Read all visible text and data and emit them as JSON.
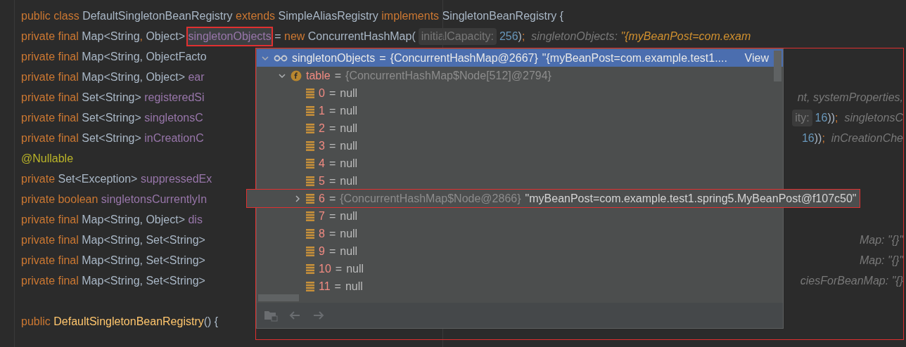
{
  "editor": {
    "lines": [
      {
        "tokens": [
          {
            "kind": "keyword",
            "text": "public class "
          },
          {
            "kind": "type",
            "text": "DefaultSingletonBeanRegistry "
          },
          {
            "kind": "keyword",
            "text": "extends "
          },
          {
            "kind": "type",
            "text": "SimpleAliasRegistry "
          },
          {
            "kind": "keyword",
            "text": "implements "
          },
          {
            "kind": "type",
            "text": "SingletonBeanRegistry {"
          }
        ]
      },
      {
        "tokens": [
          {
            "kind": "keyword",
            "text": "private final "
          },
          {
            "kind": "type",
            "text": "Map<String"
          },
          {
            "kind": "keyword",
            "text": ", "
          },
          {
            "kind": "type",
            "text": "Object> "
          },
          {
            "kind": "field",
            "text": "singletonObjects",
            "marked": true
          },
          {
            "kind": "type",
            "text": " = "
          },
          {
            "kind": "keyword",
            "text": "new "
          },
          {
            "kind": "type",
            "text": "ConcurrentHashMap("
          },
          {
            "kind": "hint",
            "text": "initialCapacity:"
          },
          {
            "kind": "number",
            "text": "256"
          },
          {
            "kind": "type",
            "text": ")"
          },
          {
            "kind": "keyword",
            "text": ";  "
          },
          {
            "kind": "inline",
            "text": "singletonObjects: "
          },
          {
            "kind": "inline-string",
            "text": "\"{myBeanPost=com.exam"
          }
        ]
      },
      {
        "tokens": [
          {
            "kind": "keyword",
            "text": "private final "
          },
          {
            "kind": "type",
            "text": "Map<String, ObjectFacto"
          }
        ]
      },
      {
        "tokens": [
          {
            "kind": "keyword",
            "text": "private final "
          },
          {
            "kind": "type",
            "text": "Map<String, Object> "
          },
          {
            "kind": "field",
            "text": "ear"
          }
        ]
      },
      {
        "tokens": [
          {
            "kind": "keyword",
            "text": "private final "
          },
          {
            "kind": "type",
            "text": "Set<String> "
          },
          {
            "kind": "field",
            "text": "registeredSi"
          }
        ],
        "right": [
          {
            "kind": "inline",
            "text": "nt, systemProperties,"
          }
        ]
      },
      {
        "tokens": [
          {
            "kind": "keyword",
            "text": "private final "
          },
          {
            "kind": "type",
            "text": "Set<String> "
          },
          {
            "kind": "field",
            "text": "singletonsC"
          }
        ],
        "right": [
          {
            "kind": "hint",
            "text": "ity:"
          },
          {
            "kind": "number",
            "text": "16"
          },
          {
            "kind": "type",
            "text": "))"
          },
          {
            "kind": "keyword",
            "text": ";  "
          },
          {
            "kind": "inline",
            "text": "singletonsC"
          }
        ]
      },
      {
        "tokens": [
          {
            "kind": "keyword",
            "text": "private final "
          },
          {
            "kind": "type",
            "text": "Set<String> "
          },
          {
            "kind": "field",
            "text": "inCreationC"
          }
        ],
        "right": [
          {
            "kind": "number",
            "text": "16"
          },
          {
            "kind": "type",
            "text": "))"
          },
          {
            "kind": "keyword",
            "text": ";  "
          },
          {
            "kind": "inline",
            "text": "inCreationChe"
          }
        ]
      },
      {
        "tokens": [
          {
            "kind": "annotation",
            "text": "@Nullable"
          }
        ]
      },
      {
        "tokens": [
          {
            "kind": "keyword",
            "text": "private "
          },
          {
            "kind": "type",
            "text": "Set<Exception> "
          },
          {
            "kind": "field",
            "text": "suppressedEx"
          }
        ]
      },
      {
        "tokens": [
          {
            "kind": "keyword",
            "text": "private boolean "
          },
          {
            "kind": "field",
            "text": "singletonsCurrentlyIn"
          }
        ]
      },
      {
        "tokens": [
          {
            "kind": "keyword",
            "text": "private final "
          },
          {
            "kind": "type",
            "text": "Map<String, Object> "
          },
          {
            "kind": "field",
            "text": "dis"
          }
        ]
      },
      {
        "tokens": [
          {
            "kind": "keyword",
            "text": "private final "
          },
          {
            "kind": "type",
            "text": "Map<String, Set<String>"
          }
        ],
        "right": [
          {
            "kind": "inline",
            "text": "Map: \"{}\""
          }
        ]
      },
      {
        "tokens": [
          {
            "kind": "keyword",
            "text": "private final "
          },
          {
            "kind": "type",
            "text": "Map<String, Set<String>"
          }
        ],
        "right": [
          {
            "kind": "inline",
            "text": "Map: \"{}\""
          }
        ]
      },
      {
        "tokens": [
          {
            "kind": "keyword",
            "text": "private final "
          },
          {
            "kind": "type",
            "text": "Map<String, Set<String>"
          }
        ],
        "right": [
          {
            "kind": "inline",
            "text": "ciesForBeanMap: \"{}"
          }
        ]
      },
      {
        "gap_before": true,
        "tokens": [
          {
            "kind": "keyword",
            "text": "public "
          },
          {
            "kind": "method",
            "text": "DefaultSingletonBeanRegistry"
          },
          {
            "kind": "type",
            "text": "() {"
          }
        ]
      }
    ]
  },
  "popup": {
    "root": {
      "kind": "watch",
      "name": "singletonObjects",
      "sep": "=",
      "value": "{ConcurrentHashMap@2667}",
      "string": "\"{myBeanPost=com.example.test1....",
      "action": "View",
      "selected": true,
      "expanded": true,
      "children": [
        {
          "kind": "field",
          "name": "table",
          "sep": "=",
          "value": "{ConcurrentHashMap$Node[512]@2794}",
          "selected": false,
          "expanded": true,
          "children": [
            {
              "kind": "leaf",
              "name": "0",
              "sep": "=",
              "value": "null",
              "selected": false
            },
            {
              "kind": "leaf",
              "name": "1",
              "sep": "=",
              "value": "null",
              "selected": false
            },
            {
              "kind": "leaf",
              "name": "2",
              "sep": "=",
              "value": "null",
              "selected": false
            },
            {
              "kind": "leaf",
              "name": "3",
              "sep": "=",
              "value": "null",
              "selected": false
            },
            {
              "kind": "leaf",
              "name": "4",
              "sep": "=",
              "value": "null",
              "selected": false
            },
            {
              "kind": "leaf",
              "name": "5",
              "sep": "=",
              "value": "null",
              "selected": false
            },
            {
              "kind": "node",
              "name": "6",
              "sep": "=",
              "value": "{ConcurrentHashMap$Node@2866}",
              "string": "\"myBeanPost=com.example.test1.spring5.MyBeanPost@f107c50\"",
              "selected": false,
              "expanded": false,
              "marked": true
            },
            {
              "kind": "leaf",
              "name": "7",
              "sep": "=",
              "value": "null",
              "selected": false
            },
            {
              "kind": "leaf",
              "name": "8",
              "sep": "=",
              "value": "null",
              "selected": false
            },
            {
              "kind": "leaf",
              "name": "9",
              "sep": "=",
              "value": "null",
              "selected": false
            },
            {
              "kind": "leaf",
              "name": "10",
              "sep": "=",
              "value": "null",
              "selected": false
            },
            {
              "kind": "leaf",
              "name": "11",
              "sep": "=",
              "value": "null",
              "selected": false
            }
          ]
        }
      ]
    },
    "toolbar": [
      {
        "kind": "folder",
        "disabled": true
      },
      {
        "kind": "back",
        "disabled": true
      },
      {
        "kind": "forward",
        "disabled": true
      }
    ]
  }
}
